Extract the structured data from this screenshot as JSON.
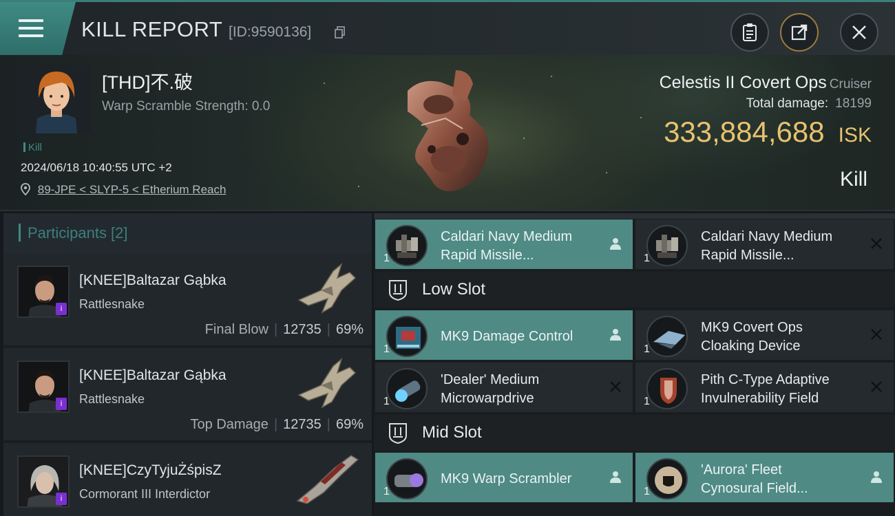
{
  "header": {
    "title": "KILL REPORT",
    "report_id": "[ID:9590136]"
  },
  "victim": {
    "name": "[THD]不.破",
    "scramble_label": "Warp Scramble Strength: 0.0",
    "kill_tag": "Kill",
    "datetime": "2024/06/18 10:40:55 UTC +2",
    "location": "89-JPE < SLYP-5 < Etherium Reach"
  },
  "ship": {
    "name": "Celestis II Covert Ops",
    "class": "Cruiser",
    "total_damage_label": "Total damage:",
    "total_damage_value": "18199",
    "isk_value": "333,884,688",
    "isk_unit": "ISK",
    "result": "Kill"
  },
  "participants": {
    "label": "Participants [2]",
    "rows": [
      {
        "name": "[KNEE]Baltazar Gąbka",
        "ship": "Rattlesnake",
        "role": "Final Blow",
        "damage": "12735",
        "percent": "69%"
      },
      {
        "name": "[KNEE]Baltazar Gąbka",
        "ship": "Rattlesnake",
        "role": "Top Damage",
        "damage": "12735",
        "percent": "69%"
      },
      {
        "name": "[KNEE]CzyTyjuŻśpisZ",
        "ship": "Cormorant III Interdictor"
      }
    ]
  },
  "modules": {
    "high": [
      {
        "name1": "Caldari Navy Medium",
        "name2": "Rapid Missile...",
        "qty": "1",
        "status": "pilot"
      },
      {
        "name1": "Caldari Navy Medium",
        "name2": "Rapid Missile...",
        "qty": "1",
        "status": "destroyed"
      }
    ],
    "low_label": "Low Slot",
    "low": [
      {
        "name1": "MK9 Damage Control",
        "name2": "",
        "qty": "1",
        "status": "pilot"
      },
      {
        "name1": "MK9 Covert Ops",
        "name2": "Cloaking Device",
        "qty": "1",
        "status": "destroyed"
      },
      {
        "name1": "'Dealer' Medium",
        "name2": "Microwarpdrive",
        "qty": "1",
        "status": "destroyed"
      },
      {
        "name1": "Pith C-Type Adaptive",
        "name2": "Invulnerability Field",
        "qty": "1",
        "status": "destroyed"
      }
    ],
    "mid_label": "Mid Slot",
    "mid": [
      {
        "name1": "MK9 Warp Scrambler",
        "name2": "",
        "qty": "1",
        "status": "pilot"
      },
      {
        "name1": "'Aurora' Fleet",
        "name2": "Cynosural Field...",
        "qty": "1",
        "status": "pilot"
      }
    ]
  },
  "colors": {
    "accent": "#3f8a84",
    "isk": "#e8c26f",
    "highlight": "#4f8a85"
  }
}
